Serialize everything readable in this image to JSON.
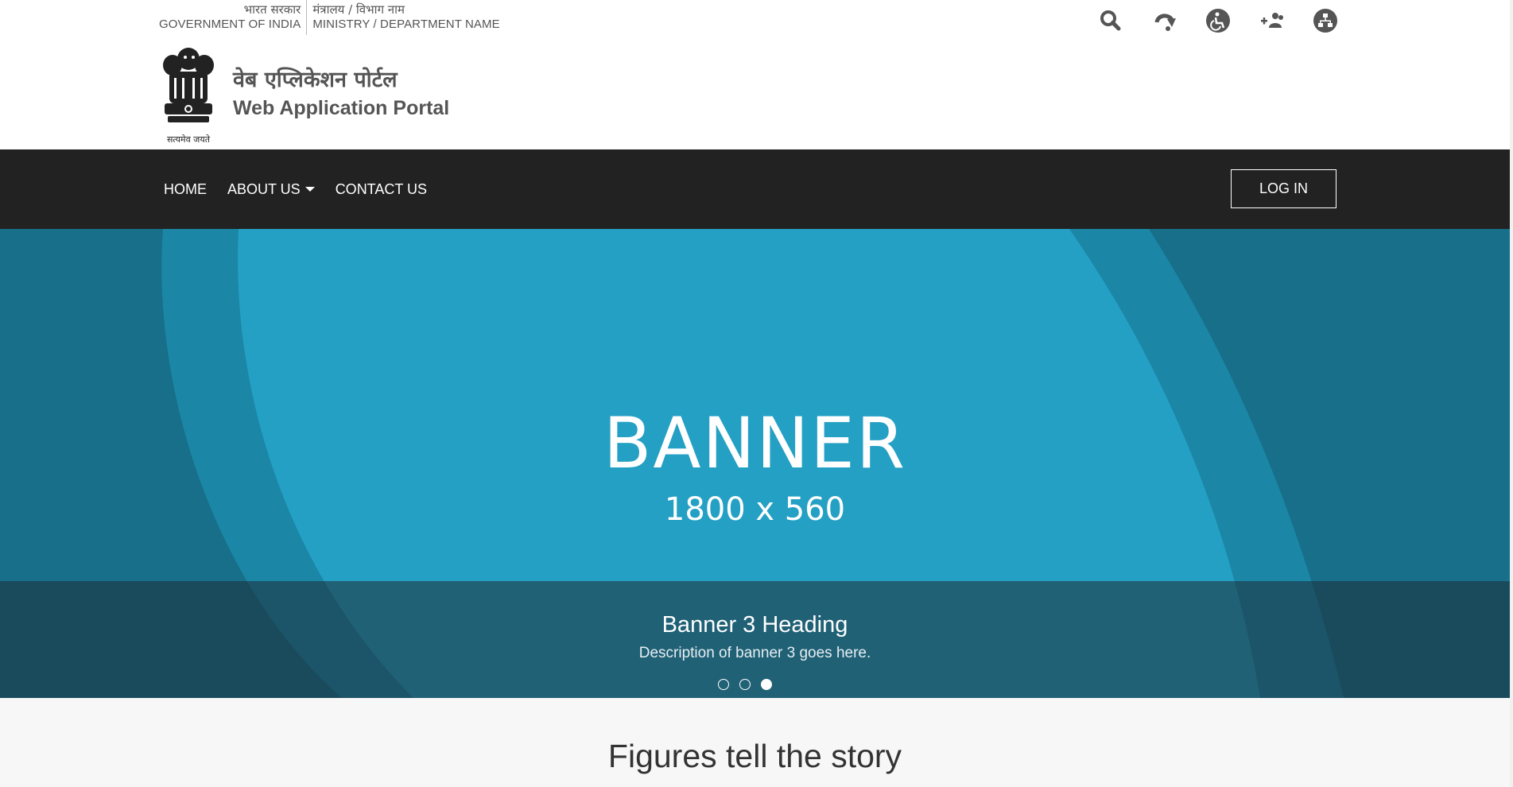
{
  "header": {
    "gov_hi": "भारत सरकार",
    "gov_en": "GOVERNMENT OF INDIA",
    "ministry_hi": "मंत्रालय / विभाग नाम",
    "ministry_en": "MINISTRY / DEPARTMENT NAME",
    "emblem_caption": "सत्यमेव जयते",
    "portal_title_hi": "वेब एप्लिकेशन पोर्टल",
    "portal_title_en": "Web Application Portal",
    "utility_icons": [
      "search-icon",
      "skip-to-content-icon",
      "accessibility-icon",
      "social-media-icon",
      "sitemap-icon"
    ]
  },
  "nav": {
    "items": [
      {
        "label": "HOME"
      },
      {
        "label": "ABOUT US"
      },
      {
        "label": "CONTACT US"
      }
    ],
    "login_label": "LOG IN"
  },
  "banner": {
    "main_text": "BANNER",
    "size_text": "1800 x 560",
    "caption_heading": "Banner 3 Heading",
    "caption_desc": "Description of banner 3 goes here.",
    "active_slide": 3,
    "slide_count": 3,
    "colors": {
      "dark": "#176f89",
      "mid": "#1b86a6",
      "light": "#24a0c4"
    }
  },
  "figures": {
    "title": "Figures tell the story"
  }
}
